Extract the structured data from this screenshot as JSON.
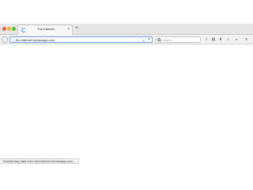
{
  "tab": {
    "title": "The Internet",
    "close_label": "×",
    "new_tab_label": "+"
  },
  "nav": {
    "back_label": "←",
    "url": "the-internet.herokuapp.com",
    "url_dropdown": "∨",
    "stop_label": "×"
  },
  "search": {
    "placeholder": "Search"
  },
  "toolbar": {
    "icons": [
      "star-icon",
      "reading-list-icon",
      "download-icon",
      "home-icon",
      "pocket-icon",
      "menu-icon"
    ]
  },
  "status": {
    "text": "Transferring data from the-internet.herokuapp.com..."
  },
  "colors": {
    "accent": "#4a90e2",
    "close_red": "#fc5b57",
    "minimize_yellow": "#e5bf3c",
    "zoom_green": "#57c038"
  }
}
